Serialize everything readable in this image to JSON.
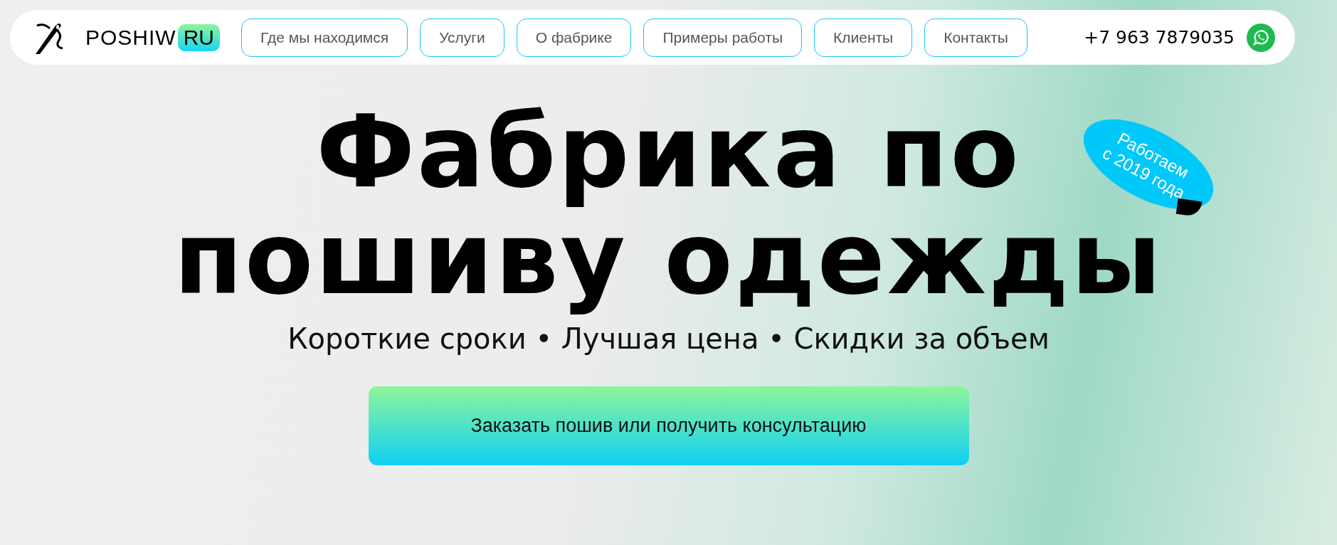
{
  "header": {
    "logo": {
      "text": "POSHIW",
      "badge": "RU"
    },
    "nav": [
      "Где мы находимся",
      "Услуги",
      "О фабрике",
      "Примеры работы",
      "Клиенты",
      "Контакты"
    ],
    "phone": "+7 963 7879035"
  },
  "hero": {
    "title_lines": [
      "Фабрика по",
      "пошиву одежды"
    ],
    "subtitle": "Короткие сроки • Лучшая цена • Скидки за объем",
    "button": "Заказать пошив или получить консультацию",
    "sticker": [
      "Работаем",
      "с 2019 года"
    ]
  }
}
